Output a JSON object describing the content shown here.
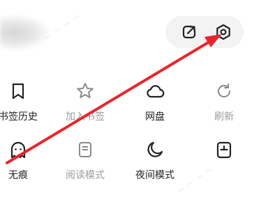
{
  "toolbar": {
    "share_icon": "share-out-icon",
    "settings_icon": "gear-icon"
  },
  "menu": {
    "rows": [
      [
        {
          "label": "书签历史",
          "icon": "bookmark-icon",
          "enabled": true
        },
        {
          "label": "加入书签",
          "icon": "star-icon",
          "enabled": false
        },
        {
          "label": "网盘",
          "icon": "cloud-icon",
          "enabled": true
        },
        {
          "label": "刷新",
          "icon": "refresh-icon",
          "enabled": false
        }
      ],
      [
        {
          "label": "无痕",
          "icon": "ghost-icon",
          "enabled": true
        },
        {
          "label": "阅读模式",
          "icon": "reader-icon",
          "enabled": false
        },
        {
          "label": "夜间模式",
          "icon": "moon-icon",
          "enabled": true
        },
        {
          "label": "",
          "icon": "screenshot-icon",
          "enabled": true
        }
      ]
    ]
  },
  "annotation": {
    "arrow_color": "#e8262c",
    "points_to": "settings-button"
  },
  "colors": {
    "text": "#222222",
    "disabled_text": "#9b9b9b",
    "pill_bg": "#f3f3f3"
  }
}
